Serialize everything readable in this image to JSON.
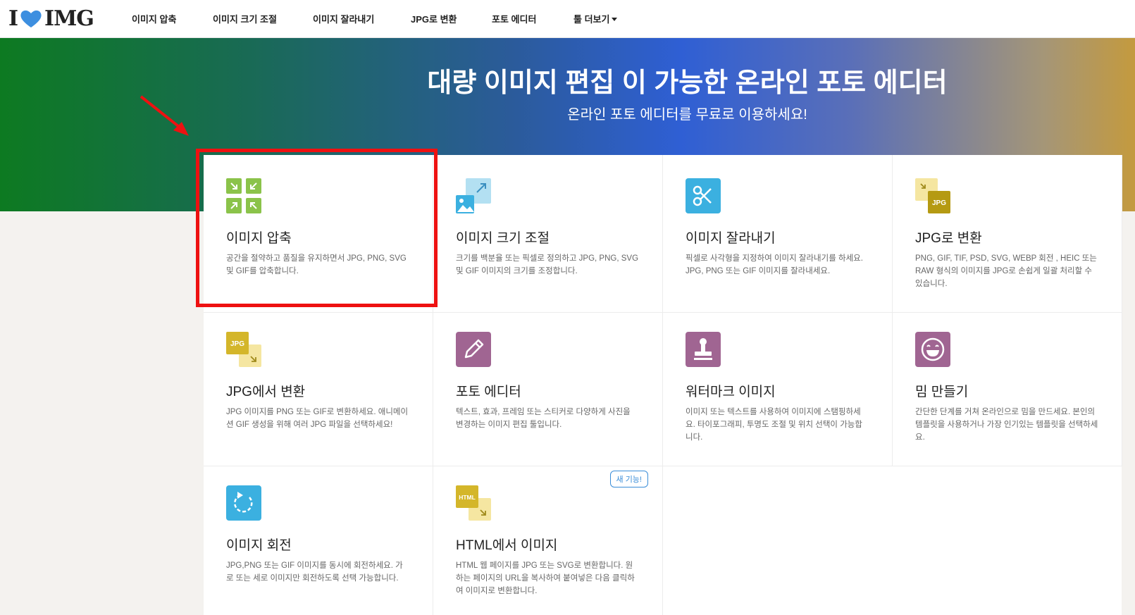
{
  "header": {
    "logo_text_1": "I",
    "logo_text_2": "IMG",
    "nav": [
      {
        "label": "이미지 압축"
      },
      {
        "label": "이미지 크기 조절"
      },
      {
        "label": "이미지 잘라내기"
      },
      {
        "label": "JPG로 변환"
      },
      {
        "label": "포토 에디터"
      },
      {
        "label": "툴 더보기"
      }
    ]
  },
  "hero": {
    "title": "대량 이미지 편집 이 가능한 온라인 포토 에디터",
    "subtitle": "온라인 포토 에디터를 무료로 이용하세요!"
  },
  "tools": [
    {
      "title": "이미지 압축",
      "desc": "공간을 절약하고 품질을 유지하면서 JPG, PNG, SVG 및 GIF를 압축합니다.",
      "icon": "compress-icon",
      "color": "#8bc34a"
    },
    {
      "title": "이미지 크기 조절",
      "desc": "크기를 백분율 또는 픽셀로 정의하고 JPG, PNG, SVG 및 GIF 이미지의 크기를 조정합니다.",
      "icon": "resize-icon",
      "color": "#5bc0de"
    },
    {
      "title": "이미지 잘라내기",
      "desc": "픽셀로 사각형을 지정하여 이미지 잘라내기를 하세요. JPG, PNG 또는 GIF 이미지를 잘라내세요.",
      "icon": "scissors-icon",
      "color": "#3bb0e0"
    },
    {
      "title": "JPG로 변환",
      "desc": "PNG, GIF, TIF, PSD, SVG, WEBP 회전 , HEIC 또는 RAW 형식의 이미지를 JPG로 손쉽게 일괄 처리할 수 있습니다.",
      "icon": "convert-to-jpg-icon",
      "color": "#c6a81b"
    },
    {
      "title": "JPG에서 변환",
      "desc": "JPG 이미지를 PNG 또는 GIF로 변환하세요. 애니메이션 GIF 생성을 위해 여러 JPG 파일을 선택하세요!",
      "icon": "convert-from-jpg-icon",
      "color": "#d4b62a"
    },
    {
      "title": "포토 에디터",
      "desc": "텍스트, 효과, 프레임 또는 스티커로 다양하게 사진을 변경하는 이미지 편집 툴입니다.",
      "icon": "pencil-icon",
      "color": "#a06592"
    },
    {
      "title": "워터마크 이미지",
      "desc": "이미지 또는 텍스트를 사용하여 이미지에 스탬핑하세요. 타이포그래피, 투명도 조절 및 위치 선택이 가능합니다.",
      "icon": "stamp-icon",
      "color": "#a06592"
    },
    {
      "title": "밈 만들기",
      "desc": "간단한 단계를 거쳐 온라인으로 밈을 만드세요. 본인의 템플릿을 사용하거나 가장 인기있는 템플릿을 선택하세요.",
      "icon": "laughing-face-icon",
      "color": "#a06592"
    },
    {
      "title": "이미지 회전",
      "desc": "JPG,PNG 또는 GIF 이미지를 동시에 회전하세요. 가로 또는 세로 이미지만 회전하도록 선택 가능합니다.",
      "icon": "rotate-icon",
      "color": "#3bb0e0"
    },
    {
      "title": "HTML에서 이미지",
      "desc": "HTML 웹 페이지를 JPG 또는 SVG로 변환합니다. 원하는 페이지의 URL을 복사하여 붙여넣은 다음 클릭하여 이미지로 변환합니다.",
      "icon": "html-to-image-icon",
      "color": "#d4b62a",
      "badge": "새 기능!"
    }
  ],
  "icon_labels": {
    "jpg": "JPG",
    "html": "HTML"
  },
  "colors": {
    "highlight": "#ee1111",
    "badge": "#3a8dd8"
  }
}
